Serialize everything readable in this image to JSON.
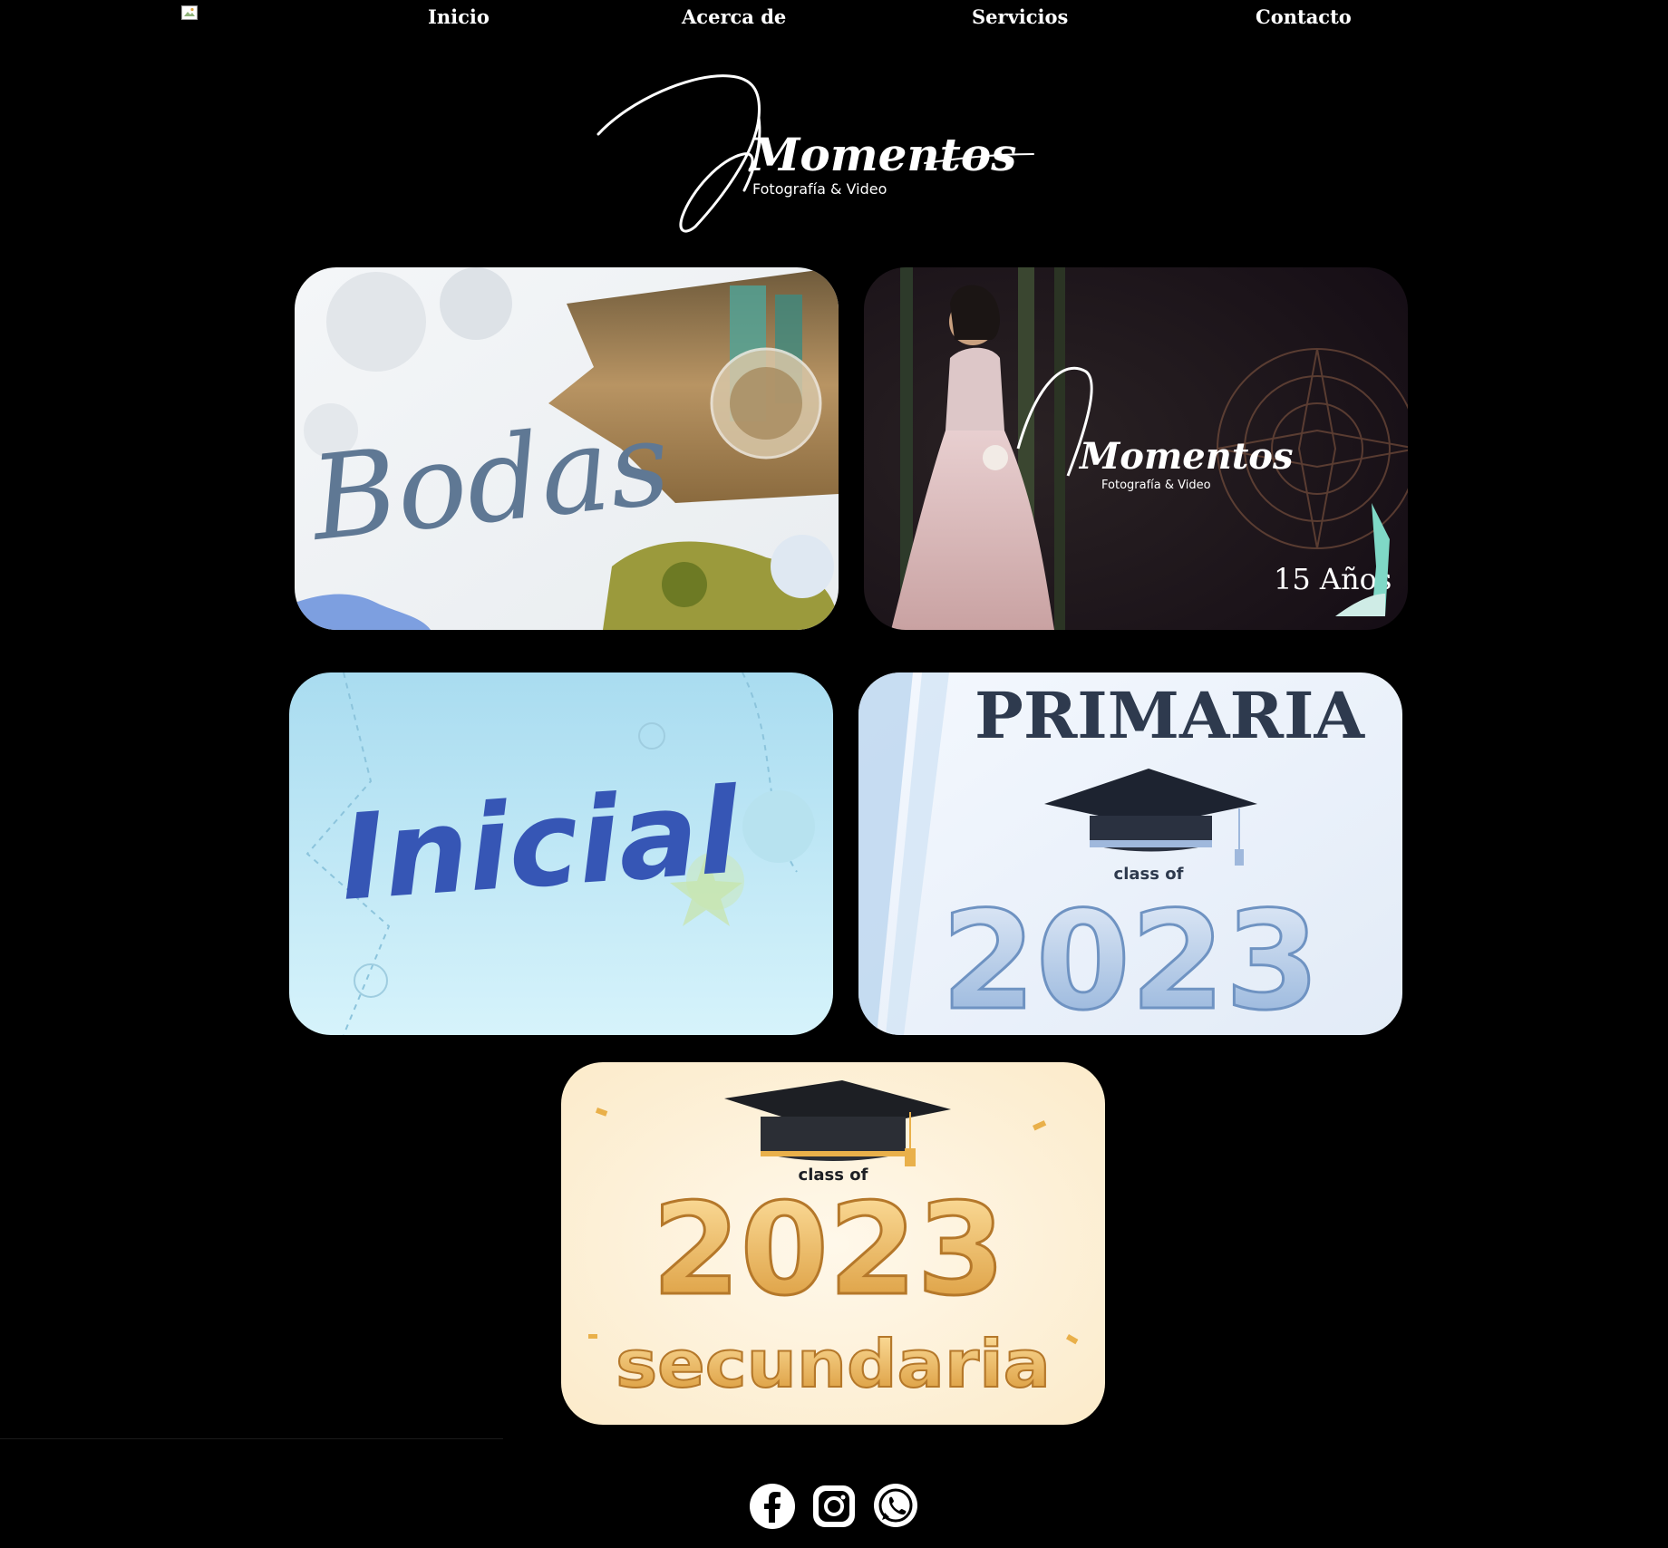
{
  "nav": {
    "items": [
      {
        "label": "Inicio"
      },
      {
        "label": "Acerca de"
      },
      {
        "label": "Servicios"
      },
      {
        "label": "Contacto"
      }
    ]
  },
  "logo": {
    "script_text": "Momentos",
    "tagline": "Fotografía & Video"
  },
  "cards": [
    {
      "title": "Bodas"
    },
    {
      "title": "Momentos",
      "subtitle": "Fotografía & Video",
      "badge": "15 Años"
    },
    {
      "title": "Inicial"
    },
    {
      "title": "PRIMARIA",
      "class_of": "class of",
      "year": "2023"
    },
    {
      "title": "secundaria",
      "class_of": "class of",
      "year": "2023"
    }
  ],
  "social": {
    "icons": [
      "facebook-icon",
      "instagram-icon",
      "whatsapp-icon"
    ]
  },
  "colors": {
    "background": "#000000",
    "text": "#ffffff",
    "bodas_script": "#5f7894",
    "inicial_script": "#3656b5",
    "primaria_title": "#2e3a4e",
    "gold": "#e9b04a"
  }
}
